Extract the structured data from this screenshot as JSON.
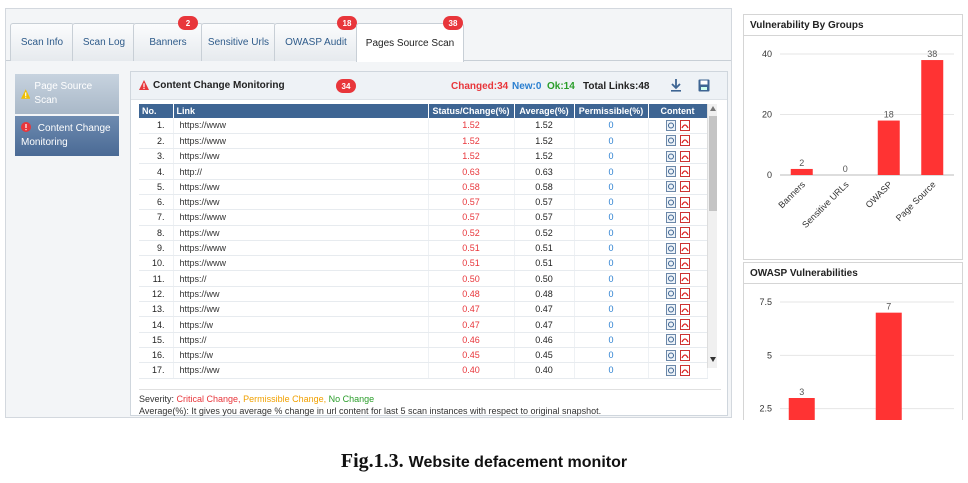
{
  "tabs": [
    {
      "label": "Scan Info",
      "badge": ""
    },
    {
      "label": "Scan Log",
      "badge": ""
    },
    {
      "label": "Banners",
      "badge": "2"
    },
    {
      "label": "Sensitive Urls",
      "badge": ""
    },
    {
      "label": "OWASP Audit",
      "badge": "18"
    },
    {
      "label": "Pages Source Scan",
      "badge": "38"
    }
  ],
  "sidebar": {
    "items": [
      {
        "label": "Page Source Scan"
      },
      {
        "label": "Content Change Monitoring"
      }
    ]
  },
  "panel": {
    "title": "Content Change Monitoring",
    "badge": "34",
    "changed": "Changed:34",
    "new": "New:0",
    "ok": "Ok:14",
    "total": "Total Links:48",
    "columns": [
      "No.",
      "Link",
      "Status/Change(%)",
      "Average(%)",
      "Permissible(%)",
      "Content"
    ]
  },
  "rows": [
    {
      "no": "1.",
      "link": "https://www",
      "status": "1.52",
      "avg": "1.52",
      "perm": "0"
    },
    {
      "no": "2.",
      "link": "https://www",
      "status": "1.52",
      "avg": "1.52",
      "perm": "0"
    },
    {
      "no": "3.",
      "link": "https://ww",
      "status": "1.52",
      "avg": "1.52",
      "perm": "0"
    },
    {
      "no": "4.",
      "link": "http://",
      "status": "0.63",
      "avg": "0.63",
      "perm": "0"
    },
    {
      "no": "5.",
      "link": "https://ww",
      "status": "0.58",
      "avg": "0.58",
      "perm": "0"
    },
    {
      "no": "6.",
      "link": "https://ww",
      "status": "0.57",
      "avg": "0.57",
      "perm": "0"
    },
    {
      "no": "7.",
      "link": "https://www",
      "status": "0.57",
      "avg": "0.57",
      "perm": "0"
    },
    {
      "no": "8.",
      "link": "https://ww",
      "status": "0.52",
      "avg": "0.52",
      "perm": "0"
    },
    {
      "no": "9.",
      "link": "https://www",
      "status": "0.51",
      "avg": "0.51",
      "perm": "0"
    },
    {
      "no": "10.",
      "link": "https://www",
      "status": "0.51",
      "avg": "0.51",
      "perm": "0"
    },
    {
      "no": "11.",
      "link": "https://",
      "status": "0.50",
      "avg": "0.50",
      "perm": "0"
    },
    {
      "no": "12.",
      "link": "https://ww",
      "status": "0.48",
      "avg": "0.48",
      "perm": "0"
    },
    {
      "no": "13.",
      "link": "https://ww",
      "status": "0.47",
      "avg": "0.47",
      "perm": "0"
    },
    {
      "no": "14.",
      "link": "https://w",
      "status": "0.47",
      "avg": "0.47",
      "perm": "0"
    },
    {
      "no": "15.",
      "link": "https://",
      "status": "0.46",
      "avg": "0.46",
      "perm": "0"
    },
    {
      "no": "16.",
      "link": "https://w",
      "status": "0.45",
      "avg": "0.45",
      "perm": "0"
    },
    {
      "no": "17.",
      "link": "https://ww",
      "status": "0.40",
      "avg": "0.40",
      "perm": "0"
    }
  ],
  "footer": {
    "severity_label": "Severity:",
    "critical": "Critical Change,",
    "permissible": "Permissible Change,",
    "nochange": "No Change",
    "note": "Average(%): It gives you average % change in url content for last 5 scan instances with respect to original snapshot."
  },
  "chart_data": [
    {
      "type": "bar",
      "title": "Vulnerability By Groups",
      "categories": [
        "Banners",
        "Sensitive URLs",
        "OWASP",
        "Page Source"
      ],
      "values": [
        2,
        0,
        18,
        38
      ],
      "ylim": [
        0,
        40
      ],
      "yticks": [
        0,
        20,
        40
      ],
      "color": "#ff3333"
    },
    {
      "type": "bar",
      "title": "OWASP Vulnerabilities",
      "categories": [
        "",
        "",
        "",
        ""
      ],
      "values": [
        3,
        0,
        7,
        0
      ],
      "ylim": [
        0,
        7.5
      ],
      "yticks": [
        2.5,
        5,
        7.5
      ],
      "color": "#ff3333"
    }
  ],
  "caption": {
    "fig": "Fig.1.3.",
    "text": "Website defacement monitor"
  },
  "colors": {
    "accent": "#3e6593",
    "critical": "#e8363b",
    "permissible": "#f0a000",
    "ok": "#2a9d2a",
    "new": "#2a7fd0"
  }
}
